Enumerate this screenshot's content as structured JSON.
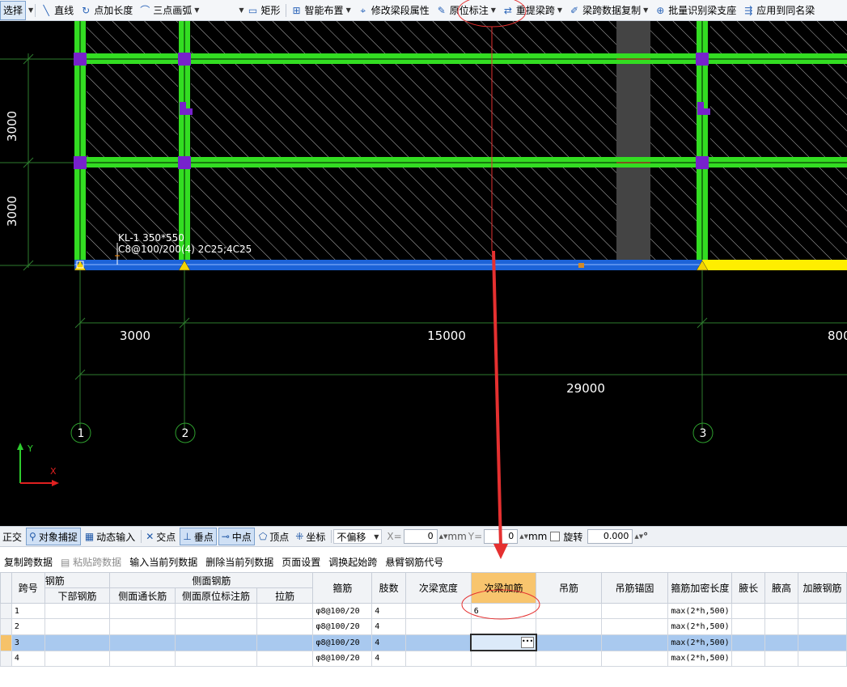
{
  "toolbar": {
    "select": "选择",
    "line": "直线",
    "point_length": "点加长度",
    "three_point_arc": "三点画弧",
    "rect": "矩形",
    "smart_layout": "智能布置",
    "modify_span_prop": "修改梁段属性",
    "in_situ_annotation": "原位标注",
    "re_extract_span": "重提梁跨",
    "span_data_copy": "梁跨数据复制",
    "batch_identify": "批量识别梁支座",
    "apply_same_name": "应用到同名梁"
  },
  "canvas": {
    "dim_left_upper": "3000",
    "dim_left_lower": "3000",
    "beam_label_line1": "KL-1 350*550",
    "beam_label_line2": "C8@100/200(4) 2C25;4C25",
    "dim_span1": "3000",
    "dim_span2": "15000",
    "dim_span3": "800",
    "dim_total": "29000",
    "axis_1": "1",
    "axis_2": "2",
    "axis_3": "3",
    "ucs_y": "Y",
    "ucs_x": "X"
  },
  "snapbar": {
    "ortho": "正交",
    "object_snap": "对象捕捉",
    "dynamic_input": "动态输入",
    "intersection": "交点",
    "perpendicular": "垂点",
    "midpoint": "中点",
    "vertex": "顶点",
    "coordinate": "坐标",
    "offset_mode": "不偏移",
    "x_label": "X=",
    "x_value": "0",
    "y_label": "Y=",
    "y_value": "0",
    "unit": "mm",
    "rotate": "旋转",
    "rotate_value": "0.000",
    "degree": "°"
  },
  "actions": {
    "copy_span_data": "复制跨数据",
    "paste_span_data": "粘贴跨数据",
    "input_current_column": "输入当前列数据",
    "delete_current_column": "删除当前列数据",
    "page_setup": "页面设置",
    "adjust_start_span": "调换起始跨",
    "cantilever_code": "悬臂钢筋代号"
  },
  "table": {
    "group_rebar": "钢筋",
    "group_side": "侧面钢筋",
    "headers": {
      "span_no": "跨号",
      "bottom_rebar": "下部钢筋",
      "side_through": "侧面通长筋",
      "side_in_situ": "侧面原位标注筋",
      "tie_bar": "拉筋",
      "stirrup": "箍筋",
      "legs": "肢数",
      "secondary_beam_width": "次梁宽度",
      "secondary_beam_rebar": "次梁加筋",
      "hanger": "吊筋",
      "hanger_anchor": "吊筋锚固",
      "stirrup_dense_length": "箍筋加密长度",
      "haunch_length": "腋长",
      "haunch_height": "腋高",
      "haunch_rebar": "加腋钢筋"
    },
    "rows": [
      {
        "span_no": "1",
        "stirrup": "φ8@100/20",
        "legs": "4",
        "secondary_beam_rebar": "6",
        "stirrup_dense_length": "max(2*h,500)"
      },
      {
        "span_no": "2",
        "stirrup": "φ8@100/20",
        "legs": "4",
        "secondary_beam_rebar": "",
        "stirrup_dense_length": "max(2*h,500)"
      },
      {
        "span_no": "3",
        "stirrup": "φ8@100/20",
        "legs": "4",
        "secondary_beam_rebar": "",
        "stirrup_dense_length": "max(2*h,500)"
      },
      {
        "span_no": "4",
        "stirrup": "φ8@100/20",
        "legs": "4",
        "secondary_beam_rebar": "",
        "stirrup_dense_length": "max(2*h,500)"
      }
    ]
  },
  "colors": {
    "canvas_bg": "#000000",
    "beam_green": "#33dd22",
    "beam_blue": "#1c63d8",
    "beam_yellow": "#ffee00",
    "column_purple": "#7722cc",
    "annotation_red": "#e53030",
    "selected_row": "#a9c9ef",
    "highlight_header": "#f8c56e"
  }
}
